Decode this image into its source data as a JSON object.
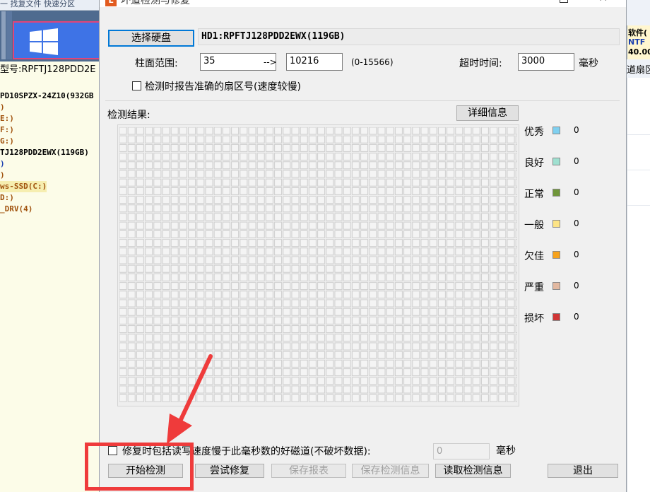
{
  "background_app": {
    "top_text": "一 找复文件 快速分区",
    "model_label": "型号:RPFTJ128PDD2E",
    "tree": [
      {
        "text": "PD10SPZX-24Z10(932GB",
        "style": "black"
      },
      {
        "text": ")",
        "style": "brown"
      },
      {
        "text": "E:)",
        "style": "brown"
      },
      {
        "text": "F:)",
        "style": "brown"
      },
      {
        "text": "G:)",
        "style": "brown"
      },
      {
        "text": "TJ128PDD2EWX(119GB)",
        "style": "black"
      },
      {
        "text": ")",
        "style": "blue"
      },
      {
        "text": ")",
        "style": "brown"
      },
      {
        "text": "ws-SSD(C:)",
        "style": "selected"
      },
      {
        "text": "D:)",
        "style": "brown"
      },
      {
        "text": "_DRV(4)",
        "style": "brown"
      }
    ],
    "right_line1": "软件(",
    "right_line2": "NTF",
    "right_line3": "40.00",
    "right_label": "道扇区"
  },
  "dialog": {
    "title": "坏道检测与修复",
    "icon_text": "L",
    "select_disk_button": "选择硬盘",
    "disk_info": "HD1:RPFTJ128PDD2EWX(119GB)",
    "cylinder_label": "柱面范围:",
    "cylinder_from": "35",
    "arrow": "-->",
    "cylinder_to": "10216",
    "cylinder_range": "(0-15566)",
    "timeout_label": "超时时间:",
    "timeout_value": "3000",
    "timeout_unit": "毫秒",
    "accurate_checkbox_label": "检测时报告准确的扇区号(速度较慢)",
    "result_label": "检测结果:",
    "detail_button": "详细信息",
    "legend": [
      {
        "name": "优秀",
        "color": "#7fd0f0",
        "count": "0"
      },
      {
        "name": "良好",
        "color": "#9fe0d0",
        "count": "0"
      },
      {
        "name": "正常",
        "color": "#70963a",
        "count": "0"
      },
      {
        "name": "一般",
        "color": "#fde486",
        "count": "0"
      },
      {
        "name": "欠佳",
        "color": "#f6a21c",
        "count": "0"
      },
      {
        "name": "严重",
        "color": "#e2b8a0",
        "count": "0"
      },
      {
        "name": "损坏",
        "color": "#d03535",
        "count": "0"
      }
    ],
    "repair_checkbox_label": "修复时包括读写速度慢于此毫秒数的好磁道(不破坏数据):",
    "repair_ms_value": "0",
    "repair_ms_unit": "毫秒",
    "buttons": {
      "start": "开始检测",
      "try_repair": "尝试修复",
      "save_report": "保存报表",
      "save_info": "保存检测信息",
      "load_info": "读取检测信息",
      "exit": "退出"
    }
  },
  "colors": {
    "annotation_red": "#ef3b3b",
    "primary_blue": "#0078d7"
  }
}
